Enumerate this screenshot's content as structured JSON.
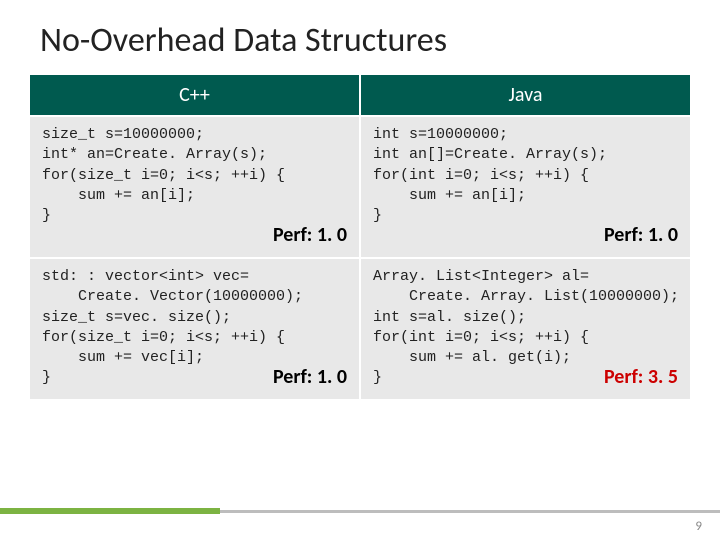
{
  "title": "No-Overhead Data Structures",
  "headers": {
    "cpp": "C++",
    "java": "Java"
  },
  "perf_label": "Perf:",
  "cells": {
    "cpp_array": {
      "lines": [
        "size_t s=10000000;",
        "int* an=Create. Array(s);",
        "for(size_t i=0; i<s; ++i) {",
        "    sum += an[i];",
        "}"
      ],
      "perf": "1. 0",
      "red": false
    },
    "java_array": {
      "lines": [
        "int s=10000000;",
        "int an[]=Create. Array(s);",
        "for(int i=0; i<s; ++i) {",
        "    sum += an[i];",
        "}"
      ],
      "perf": "1. 0",
      "red": false
    },
    "cpp_vector": {
      "lines": [
        "std: : vector<int> vec=",
        "    Create. Vector(10000000);",
        "size_t s=vec. size();",
        "for(size_t i=0; i<s; ++i) {",
        "    sum += vec[i];",
        "}"
      ],
      "perf": "1. 0",
      "red": false
    },
    "java_arraylist": {
      "lines": [
        "Array. List<Integer> al=",
        "    Create. Array. List(10000000);",
        "int s=al. size();",
        "for(int i=0; i<s; ++i) {",
        "    sum += al. get(i);",
        "}"
      ],
      "perf": "3. 5",
      "red": true
    }
  },
  "page_number": "9"
}
